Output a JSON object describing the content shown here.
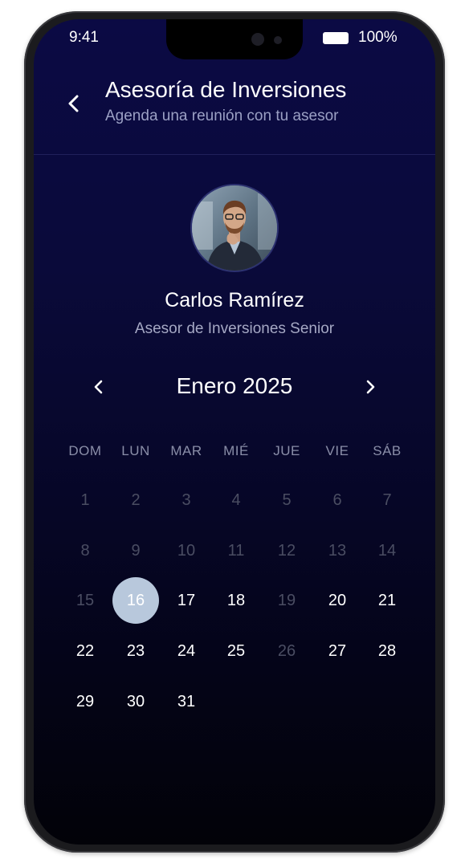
{
  "status_bar": {
    "time": "9:41",
    "battery": "100%"
  },
  "header": {
    "title": "Asesoría de Inversiones",
    "subtitle": "Agenda una reunión con tu asesor"
  },
  "advisor": {
    "name": "Carlos Ramírez",
    "role": "Asesor de Inversiones Senior"
  },
  "calendar": {
    "month_label": "Enero 2025",
    "weekdays": [
      "DOM",
      "LUN",
      "MAR",
      "MIÉ",
      "JUE",
      "VIE",
      "SÁB"
    ],
    "selected_day": "16",
    "weeks": [
      [
        {
          "label": "1",
          "available": false
        },
        {
          "label": "2",
          "available": false
        },
        {
          "label": "3",
          "available": false
        },
        {
          "label": "4",
          "available": false
        },
        {
          "label": "5",
          "available": false
        },
        {
          "label": "6",
          "available": false
        },
        {
          "label": "7",
          "available": false
        }
      ],
      [
        {
          "label": "8",
          "available": false
        },
        {
          "label": "9",
          "available": false
        },
        {
          "label": "10",
          "available": false
        },
        {
          "label": "11",
          "available": false
        },
        {
          "label": "12",
          "available": false
        },
        {
          "label": "13",
          "available": false
        },
        {
          "label": "14",
          "available": false
        }
      ],
      [
        {
          "label": "15",
          "available": false
        },
        {
          "label": "16",
          "available": true,
          "selected": true
        },
        {
          "label": "17",
          "available": true
        },
        {
          "label": "18",
          "available": true
        },
        {
          "label": "19",
          "available": false
        },
        {
          "label": "20",
          "available": true
        },
        {
          "label": "21",
          "available": true
        }
      ],
      [
        {
          "label": "22",
          "available": true
        },
        {
          "label": "23",
          "available": true
        },
        {
          "label": "24",
          "available": true
        },
        {
          "label": "25",
          "available": true
        },
        {
          "label": "26",
          "available": false
        },
        {
          "label": "27",
          "available": true
        },
        {
          "label": "28",
          "available": true
        }
      ],
      [
        {
          "label": "29",
          "available": true
        },
        {
          "label": "30",
          "available": true
        },
        {
          "label": "31",
          "available": true
        }
      ]
    ]
  },
  "colors": {
    "background_top": "#0b0a44",
    "background_bottom": "#020208",
    "selected_day": "#b8c8dc",
    "disabled_day": "#4a4d62",
    "subtitle": "#9ba0c4"
  },
  "icons": {
    "back": "chevron-left-icon",
    "prev_month": "chevron-left-icon",
    "next_month": "chevron-right-icon",
    "battery": "battery-icon"
  }
}
